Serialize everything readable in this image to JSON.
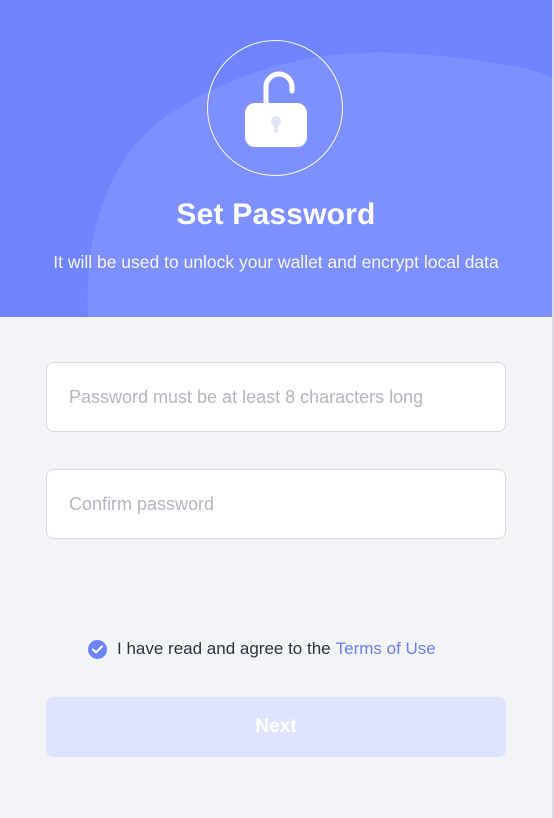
{
  "header": {
    "title": "Set Password",
    "subtitle": "It will be used to unlock your wallet and encrypt local data",
    "icon": "lock-open-icon",
    "accent_color": "#7084ff"
  },
  "form": {
    "password": {
      "value": "",
      "placeholder": "Password must be at least 8 characters long"
    },
    "confirm": {
      "value": "",
      "placeholder": "Confirm password"
    }
  },
  "agreement": {
    "checked": true,
    "icon": "check-icon",
    "text": "I have read and agree to the",
    "link_text": "Terms of Use"
  },
  "actions": {
    "next_label": "Next"
  }
}
